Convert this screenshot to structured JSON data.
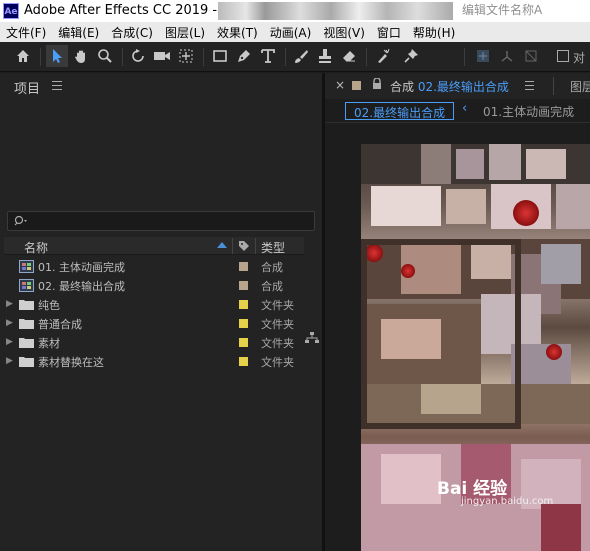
{
  "titlebar": {
    "logo": "Ae",
    "title": "Adobe After Effects CC 2019 - F:\\",
    "tail": "编辑文件名称A"
  },
  "menu": [
    "文件(F)",
    "编辑(E)",
    "合成(C)",
    "图层(L)",
    "效果(T)",
    "动画(A)",
    "视图(V)",
    "窗口",
    "帮助(H)"
  ],
  "toolbar": {
    "tools": [
      "home-icon",
      "selection-icon",
      "hand-icon",
      "zoom-icon",
      "rotate-icon",
      "camera-icon",
      "pan-behind-icon",
      "rectangle-icon",
      "pen-icon",
      "text-icon",
      "brush-icon",
      "stamp-icon",
      "eraser-icon",
      "roto-brush-icon",
      "puppet-pin-icon"
    ],
    "snap_label": "对"
  },
  "project_panel": {
    "title": "项目",
    "search_placeholder": "",
    "columns": {
      "name": "名称",
      "type": "类型"
    },
    "items": [
      {
        "name": "01. 主体动画完成",
        "type": "合成",
        "kind": "composition",
        "color": "#b7a48c"
      },
      {
        "name": "02. 最终输出合成",
        "type": "合成",
        "kind": "composition",
        "color": "#b7a48c"
      },
      {
        "name": "纯色",
        "type": "文件夹",
        "kind": "folder",
        "color": "#e6d24a"
      },
      {
        "name": "普通合成",
        "type": "文件夹",
        "kind": "folder",
        "color": "#e6d24a"
      },
      {
        "name": "素材",
        "type": "文件夹",
        "kind": "folder",
        "color": "#e6d24a"
      },
      {
        "name": "素材替换在这",
        "type": "文件夹",
        "kind": "folder",
        "color": "#e6d24a"
      }
    ]
  },
  "composition_panel": {
    "close": "×",
    "tab_prefix": "合成",
    "tab_comp_name": "02.最终输出合成",
    "footage_tab": "图层",
    "breadcrumb_active": "02.最终输出合成",
    "breadcrumb_next": "01.主体动画完成"
  },
  "watermark": {
    "main": "Bai 经验",
    "sub": "jingyan.baidu.com"
  },
  "colors": {
    "accent": "#4a9df8",
    "panel_bg": "#232323",
    "comp_label": "#b7a48c",
    "folder_label": "#e6d24a"
  }
}
